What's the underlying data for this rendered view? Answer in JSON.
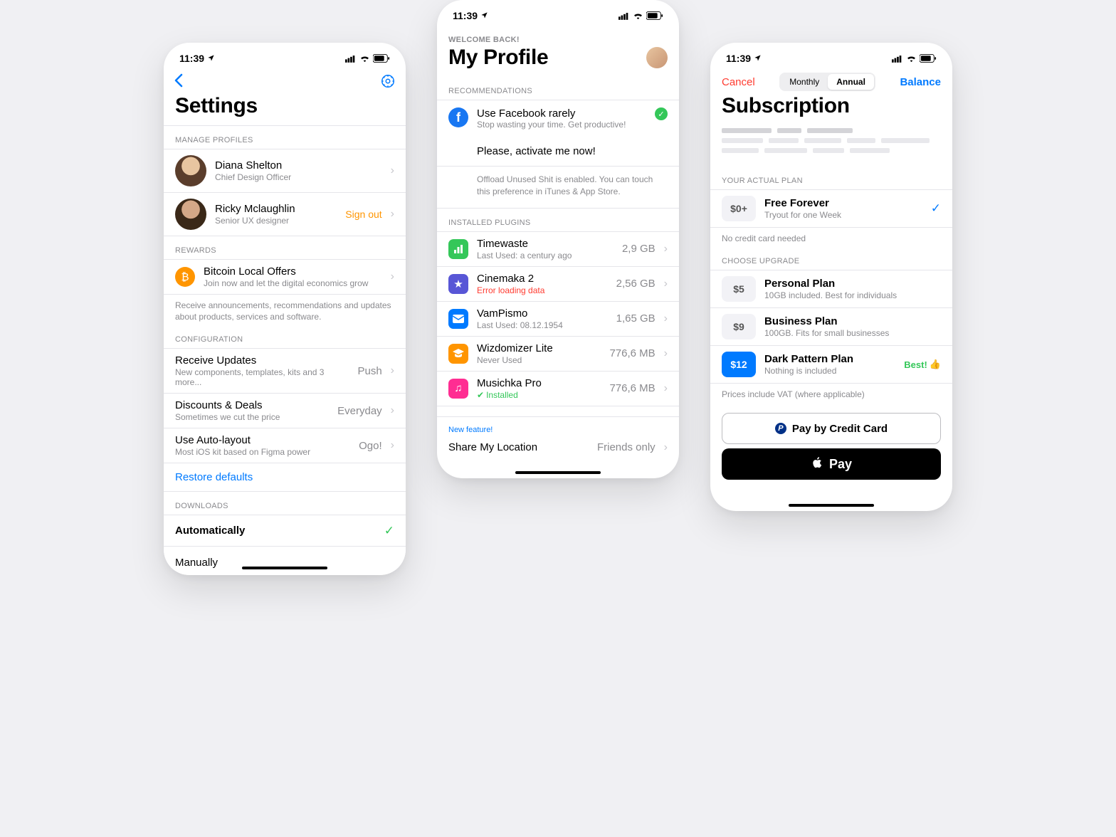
{
  "status": {
    "time": "11:39"
  },
  "screen1": {
    "title": "Settings",
    "sections": {
      "profiles_header": "MANAGE PROFILES",
      "rewards_header": "REWARDS",
      "config_header": "CONFIGURATION",
      "downloads_header": "DOWNLOADS"
    },
    "profiles": [
      {
        "name": "Diana Shelton",
        "role": "Chief Design Officer"
      },
      {
        "name": "Ricky Mclaughlin",
        "role": "Senior UX designer",
        "action": "Sign out"
      }
    ],
    "rewards": {
      "title": "Bitcoin Local Offers",
      "sub": "Join now and let the digital economics grow",
      "footer": "Receive announcements, recommendations and updates about products, services and software."
    },
    "config": [
      {
        "title": "Receive Updates",
        "sub": "New components, templates, kits and 3 more...",
        "value": "Push"
      },
      {
        "title": "Discounts & Deals",
        "sub": "Sometimes we cut the price",
        "value": "Everyday"
      },
      {
        "title": "Use Auto-layout",
        "sub": "Most iOS kit based on Figma power",
        "value": "Ogo!"
      }
    ],
    "restore_link": "Restore defaults",
    "downloads": [
      {
        "label": "Automatically",
        "selected": true
      },
      {
        "label": "Manually",
        "selected": false
      }
    ]
  },
  "screen2": {
    "welcome": "WELCOME BACK!",
    "title": "My Profile",
    "rec_header": "RECOMMENDATIONS",
    "rec": {
      "title": "Use Facebook rarely",
      "sub": "Stop wasting your time. Get productive!",
      "activate": "Please, activate me now!",
      "note": "Offload Unused Shit is enabled. You can touch this preference in iTunes & App Store."
    },
    "plugins_header": "INSTALLED PLUGINS",
    "plugins": [
      {
        "name": "Timewaste",
        "sub": "Last Used: a century ago",
        "size": "2,9 GB",
        "color": "#34c759",
        "icon": "bars"
      },
      {
        "name": "Cinemaka 2",
        "sub": "Error loading data",
        "size": "2,56 GB",
        "color": "#5856d6",
        "icon": "star",
        "error": true
      },
      {
        "name": "VamPismo",
        "sub": "Last Used: 08.12.1954",
        "size": "1,65 GB",
        "color": "#007aff",
        "icon": "mail"
      },
      {
        "name": "Wizdomizer Lite",
        "sub": "Never Used",
        "size": "776,6 MB",
        "color": "#ff9500",
        "icon": "cap"
      },
      {
        "name": "Musichka Pro",
        "sub": "Installed",
        "size": "776,6 MB",
        "color": "#ff2d92",
        "icon": "music",
        "installed": true
      }
    ],
    "share": {
      "new": "New feature!",
      "title": "Share My Location",
      "value": "Friends only"
    }
  },
  "screen3": {
    "cancel": "Cancel",
    "balance": "Balance",
    "seg": {
      "monthly": "Monthly",
      "annual": "Annual"
    },
    "title": "Subscription",
    "plan_header": "YOUR ACTUAL PLAN",
    "current": {
      "price": "$0+",
      "title": "Free Forever",
      "sub": "Tryout for one Week"
    },
    "current_footer": "No credit card needed",
    "upgrade_header": "CHOOSE UPGRADE",
    "plans": [
      {
        "price": "$5",
        "title": "Personal Plan",
        "sub": "10GB included. Best for individuals"
      },
      {
        "price": "$9",
        "title": "Business Plan",
        "sub": "100GB. Fits for small businesses"
      },
      {
        "price": "$12",
        "title": "Dark Pattern Plan",
        "sub": "Nothing is included",
        "best": "Best!",
        "highlight": true
      }
    ],
    "vat": "Prices include VAT (where applicable)",
    "pay_cc": "Pay by Credit Card",
    "pay_apple": "Pay"
  }
}
